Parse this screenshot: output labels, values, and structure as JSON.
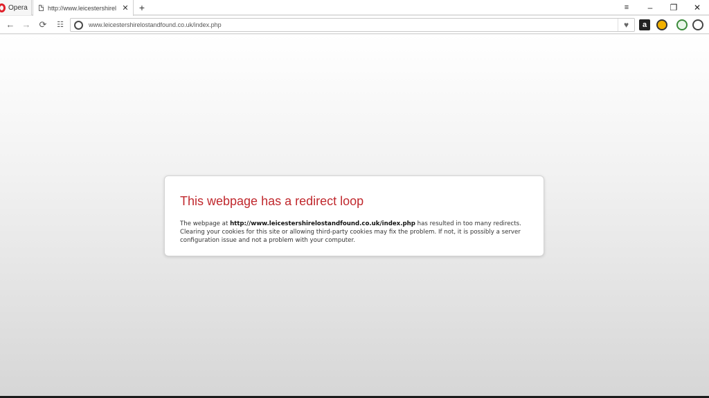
{
  "browser": {
    "menu_label": "Opera",
    "tab": {
      "title": "http://www.leicestershirel",
      "close_glyph": "✕"
    },
    "new_tab_glyph": "+",
    "window_controls": {
      "tab_menu_glyph": "≡",
      "minimize": "–",
      "restore": "❐",
      "close": "✕"
    },
    "nav": {
      "back": "←",
      "forward": "→",
      "reload": "⟳",
      "speed_dial": "☷"
    },
    "url": "www.leicestershirelostandfound.co.uk/index.php",
    "bookmark_glyph": "♥",
    "extensions": [
      {
        "name": "amazon-icon",
        "glyph": "a"
      }
    ]
  },
  "error": {
    "title": "This webpage has a redirect loop",
    "body_prefix": "The webpage at ",
    "body_url": "http://www.leicestershirelostandfound.co.uk/index.php",
    "body_suffix": " has resulted in too many redirects. Clearing your cookies for this site or allowing third-party cookies may fix the problem. If not, it is possibly a server configuration issue and not a problem with your computer."
  }
}
